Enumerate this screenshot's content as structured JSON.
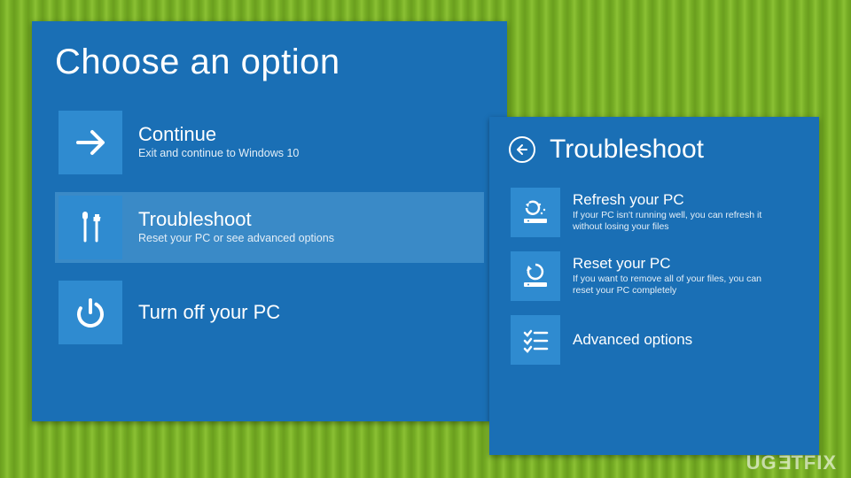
{
  "colors": {
    "panel": "#1a6fb5",
    "tile": "#2f8bd0",
    "selected": "#3a8ac7"
  },
  "main": {
    "title": "Choose an option",
    "options": [
      {
        "icon": "arrow-right",
        "title": "Continue",
        "desc": "Exit and continue to Windows 10",
        "selected": false
      },
      {
        "icon": "tools",
        "title": "Troubleshoot",
        "desc": "Reset your PC or see advanced options",
        "selected": true
      },
      {
        "icon": "power",
        "title": "Turn off your PC",
        "desc": "",
        "selected": false
      }
    ]
  },
  "sub": {
    "title": "Troubleshoot",
    "back_icon": "arrow-left",
    "options": [
      {
        "icon": "refresh-pc",
        "title": "Refresh your PC",
        "desc": "If your PC isn't running well, you can refresh it without losing your files"
      },
      {
        "icon": "reset-pc",
        "title": "Reset your PC",
        "desc": "If you want to remove all of your files, you can reset your PC completely"
      },
      {
        "icon": "advanced",
        "title": "Advanced options",
        "desc": ""
      }
    ]
  },
  "watermark": "UGETFIX"
}
